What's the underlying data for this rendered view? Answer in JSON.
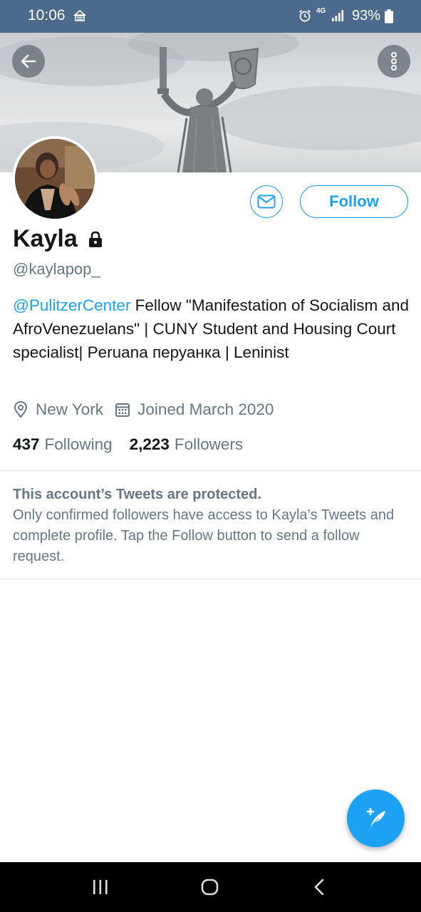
{
  "status_bar": {
    "time": "10:06",
    "battery": "93%",
    "network": "4G"
  },
  "profile": {
    "name": "Kayla",
    "handle": "@kaylapop_",
    "bio_mention": "@PulitzerCenter",
    "bio_text": " Fellow \"Manifestation of Socialism and AfroVenezuelans\" | CUNY Student and Housing Court specialist| Peruana перуанка | Leninist",
    "location": "New York",
    "joined": "Joined March 2020",
    "following_count": "437",
    "following_label": "Following",
    "followers_count": "2,223",
    "followers_label": "Followers"
  },
  "actions": {
    "follow_label": "Follow"
  },
  "protected_notice": {
    "title": "This account’s Tweets are protected.",
    "body": "Only confirmed followers have access to Kayla’s Tweets and complete profile. Tap the Follow button to send a follow request."
  },
  "icons": {
    "back": "arrow-left-icon",
    "more": "more-vertical-icon",
    "message": "envelope-icon",
    "lock": "lock-icon",
    "location": "map-pin-icon",
    "calendar": "calendar-icon",
    "compose": "compose-tweet-icon"
  },
  "colors": {
    "accent": "#1da1f2",
    "status_bar": "#4b6a8c",
    "secondary_text": "#657786"
  }
}
